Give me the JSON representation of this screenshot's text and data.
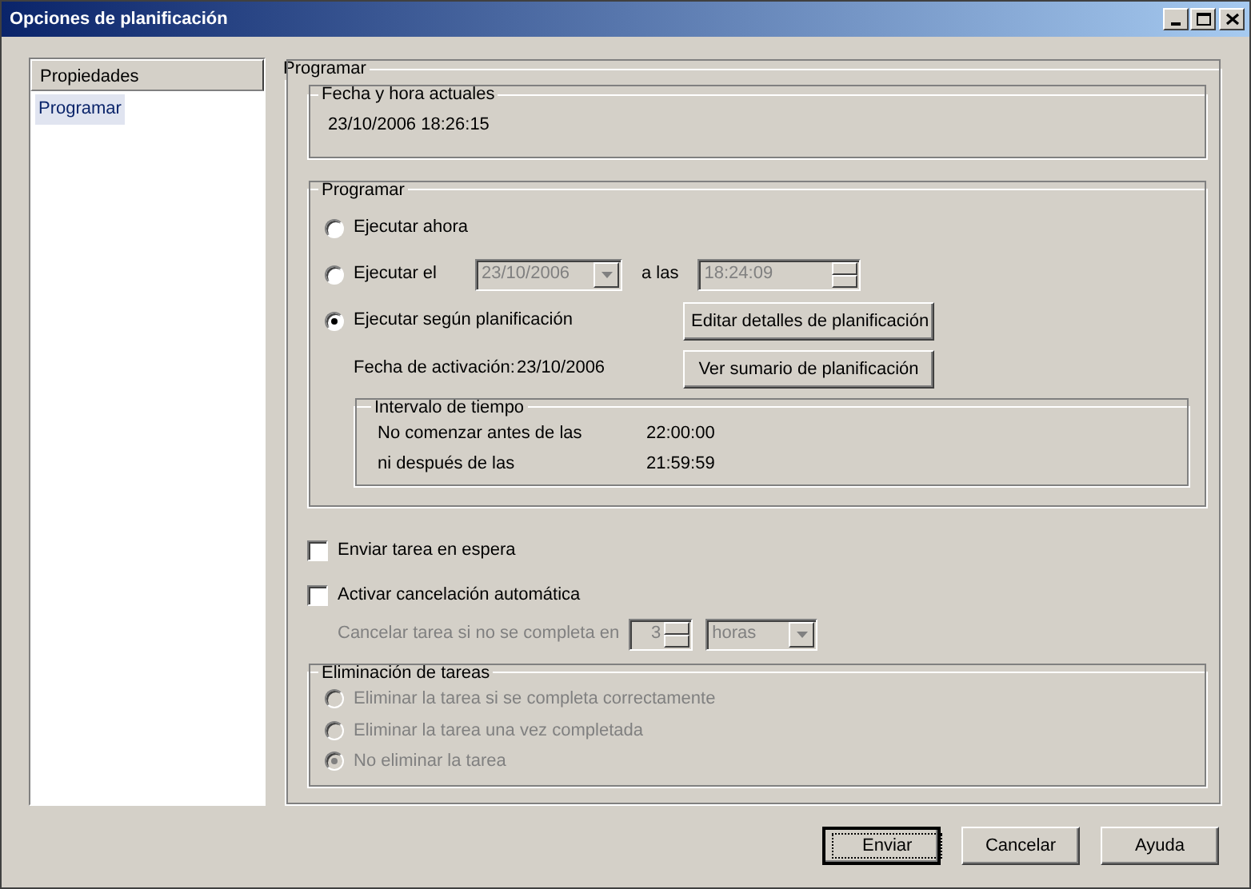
{
  "window": {
    "title": "Opciones de planificación"
  },
  "sidebar": {
    "header": "Propiedades",
    "items": [
      {
        "label": "Programar",
        "selected": true
      }
    ]
  },
  "panel": {
    "title": "Programar",
    "current": {
      "title": "Fecha y hora actuales",
      "value": "23/10/2006 18:26:15"
    },
    "schedule": {
      "title": "Programar",
      "options": [
        {
          "kind": "plain",
          "label": "Ejecutar ahora",
          "selected": false
        },
        {
          "kind": "datetime",
          "label": "Ejecutar el",
          "selected": false,
          "date": "23/10/2006",
          "time_label": "a las",
          "time": "18:24:09",
          "disabled": true
        },
        {
          "kind": "plan",
          "label": "Ejecutar según planificación",
          "selected": true,
          "button": "Editar detalles de planificación"
        }
      ],
      "activation": {
        "label": "Fecha de activación:",
        "value": "23/10/2006",
        "button": "Ver sumario de planificación"
      },
      "interval": {
        "title": "Intervalo de tiempo",
        "rows": [
          {
            "label": "No comenzar antes de las",
            "value": "22:00:00"
          },
          {
            "label": "ni después de las",
            "value": "21:59:59"
          }
        ]
      }
    },
    "checks": [
      {
        "label": "Enviar tarea en espera",
        "checked": false
      },
      {
        "label": "Activar cancelación automática",
        "checked": false
      }
    ],
    "cancel_after": {
      "label": "Cancelar tarea si no se completa en",
      "value": "3",
      "unit": "horas",
      "disabled": true
    },
    "deletion": {
      "title": "Eliminación de tareas",
      "disabled": true,
      "options": [
        {
          "label": "Eliminar la tarea si se completa correctamente",
          "selected": false
        },
        {
          "label": "Eliminar la tarea una vez completada",
          "selected": false
        },
        {
          "label": "No eliminar la tarea",
          "selected": true
        }
      ]
    }
  },
  "buttons": [
    {
      "label": "Enviar",
      "default": true
    },
    {
      "label": "Cancelar",
      "default": false
    },
    {
      "label": "Ayuda",
      "default": false
    }
  ]
}
